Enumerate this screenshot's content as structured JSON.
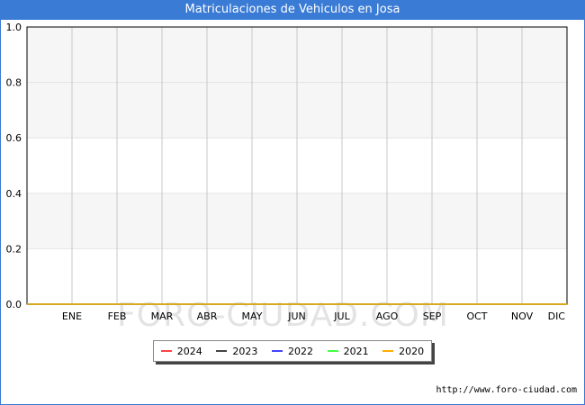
{
  "title": "Matriculaciones de Vehiculos en Josa",
  "watermark": "FORO-CIUDAD.COM",
  "footer": "http://www.foro-ciudad.com",
  "colors": {
    "title_bg": "#3a7bd5",
    "band": "#f6f6f6",
    "grid": "#c8c8c8"
  },
  "chart_data": {
    "type": "line",
    "title": "Matriculaciones de Vehiculos en Josa",
    "categories": [
      "ENE",
      "FEB",
      "MAR",
      "ABR",
      "MAY",
      "JUN",
      "JUL",
      "AGO",
      "SEP",
      "OCT",
      "NOV",
      "DIC"
    ],
    "ylim": [
      0,
      1.0
    ],
    "yticks": [
      "0.0",
      "0.2",
      "0.4",
      "0.6",
      "0.8",
      "1.0"
    ],
    "grid": true,
    "legend_position": "bottom",
    "series": [
      {
        "name": "2024",
        "color": "#ff4444",
        "values": [
          0,
          0,
          0,
          0,
          0,
          0,
          0,
          0,
          0,
          0,
          0,
          0
        ]
      },
      {
        "name": "2023",
        "color": "#444444",
        "values": [
          0,
          0,
          0,
          0,
          0,
          0,
          0,
          0,
          0,
          0,
          0,
          0
        ]
      },
      {
        "name": "2022",
        "color": "#4444ff",
        "values": [
          0,
          0,
          0,
          0,
          0,
          0,
          0,
          0,
          0,
          0,
          0,
          0
        ]
      },
      {
        "name": "2021",
        "color": "#44ff44",
        "values": [
          0,
          0,
          0,
          0,
          0,
          0,
          0,
          0,
          0,
          0,
          0,
          0
        ]
      },
      {
        "name": "2020",
        "color": "#ffaa00",
        "values": [
          0,
          0,
          0,
          0,
          0,
          0,
          0,
          0,
          0,
          0,
          0,
          0
        ]
      }
    ]
  }
}
